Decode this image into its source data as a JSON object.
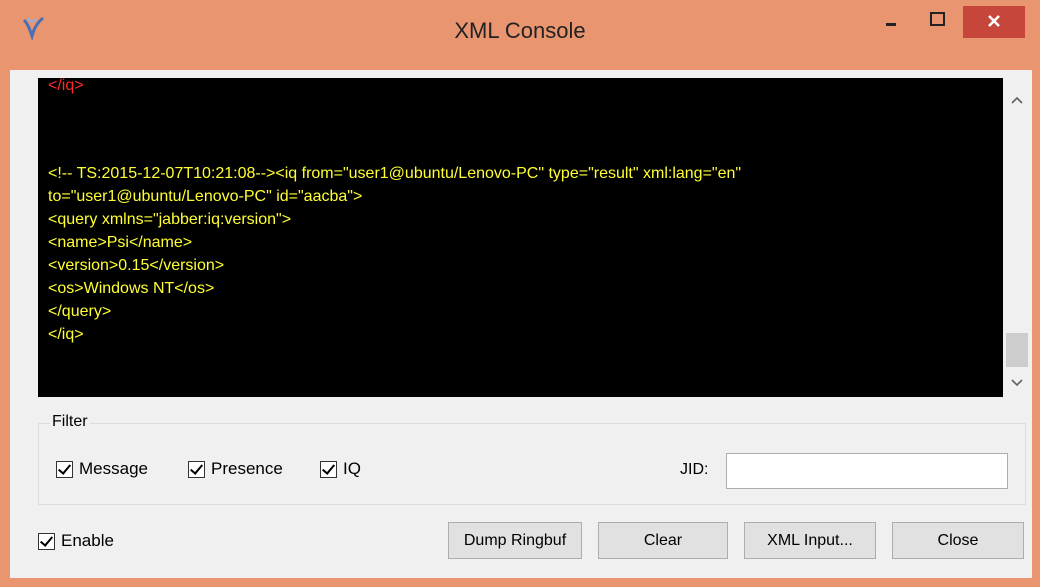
{
  "window": {
    "title": "XML Console",
    "controls": {
      "minimize": "–",
      "maximize": "☐",
      "close": "✕"
    },
    "icon": "psi-app-icon"
  },
  "console": {
    "lines": [
      {
        "text": "</iq>",
        "color": "red"
      },
      {
        "text": "<!-- TS:2015-12-07T10:21:08--><iq from=\"user1@ubuntu/Lenovo-PC\" type=\"result\" xml:lang=\"en\"",
        "color": "yellow"
      },
      {
        "text": "to=\"user1@ubuntu/Lenovo-PC\" id=\"aacba\">",
        "color": "yellow"
      },
      {
        "text": "<query xmlns=\"jabber:iq:version\">",
        "color": "yellow"
      },
      {
        "text": "<name>Psi</name>",
        "color": "yellow"
      },
      {
        "text": "<version>0.15</version>",
        "color": "yellow"
      },
      {
        "text": "<os>Windows NT</os>",
        "color": "yellow"
      },
      {
        "text": "</query>",
        "color": "yellow"
      },
      {
        "text": "</iq>",
        "color": "yellow"
      }
    ]
  },
  "filter": {
    "title": "Filter",
    "message_label": "Message",
    "presence_label": "Presence",
    "iq_label": "IQ",
    "message_checked": true,
    "presence_checked": true,
    "iq_checked": true,
    "jid_label": "JID:",
    "jid_value": ""
  },
  "bottom": {
    "enable_label": "Enable",
    "enable_checked": true,
    "dump_label": "Dump Ringbuf",
    "clear_label": "Clear",
    "xml_input_label": "XML Input...",
    "close_label": "Close"
  },
  "colors": {
    "titlebar": "#e9956f",
    "close_button": "#c7463c",
    "console_bg": "#000000",
    "incoming_text": "#ff2b2b",
    "outgoing_text": "#ffff33"
  }
}
